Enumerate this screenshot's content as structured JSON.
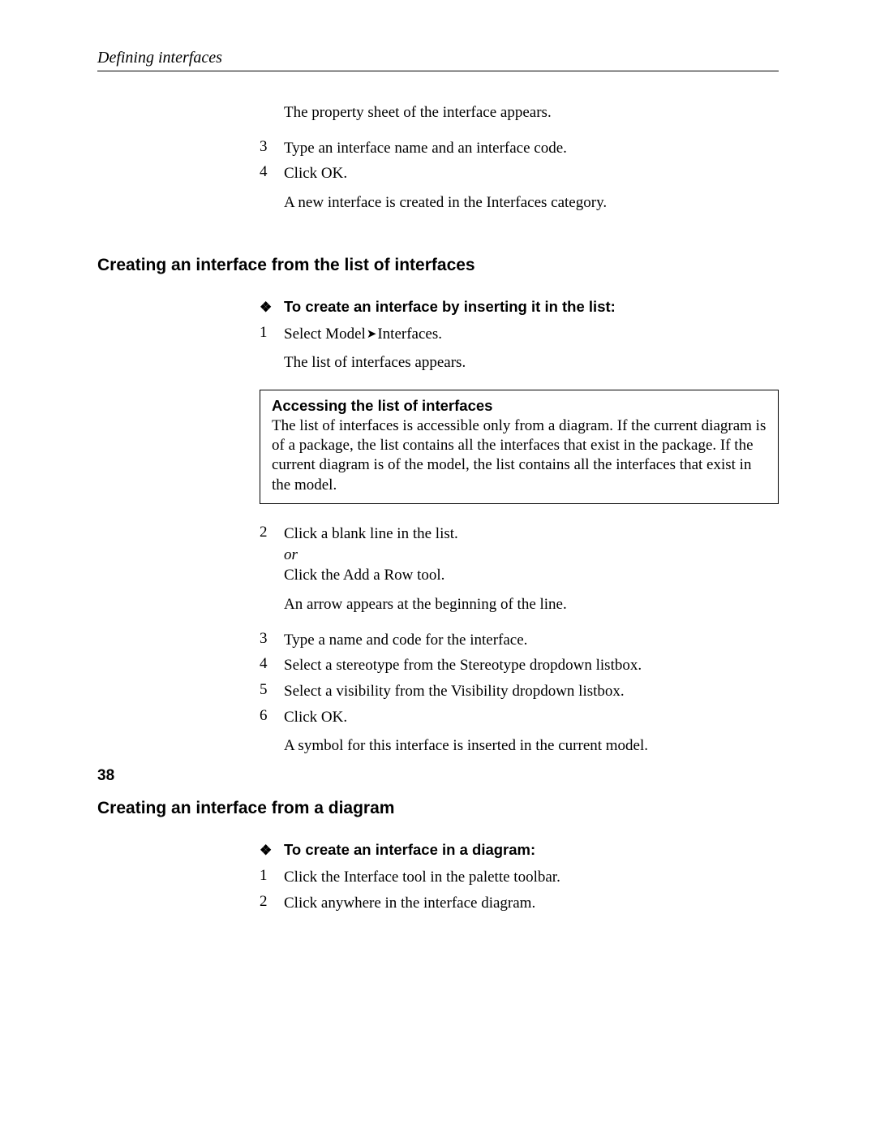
{
  "header": {
    "running_title": "Defining interfaces"
  },
  "intro_continuation": {
    "result1": "The property sheet of the interface appears.",
    "step3_num": "3",
    "step3": "Type an interface name and an interface code.",
    "step4_num": "4",
    "step4": "Click OK.",
    "result2": "A new interface is created in the Interfaces category."
  },
  "section_list": {
    "heading": "Creating an interface from the list of interfaces",
    "proc_heading": "To create an interface by inserting it in the list:",
    "step1_num": "1",
    "step1_pre": "Select Model",
    "step1_post": "Interfaces.",
    "step1_result": "The list of interfaces appears.",
    "note": {
      "title": "Accessing the list of interfaces",
      "body": "The list of interfaces is accessible only from a diagram. If the current diagram is of a package, the list contains all the interfaces that exist in the package. If the current diagram is of the model, the list contains all the interfaces that exist in the model."
    },
    "step2_num": "2",
    "step2_a": "Click a blank line in the list.",
    "step2_or": "or",
    "step2_b": "Click the Add a Row tool.",
    "step2_result": "An arrow appears at the beginning of the line.",
    "step3_num": "3",
    "step3": "Type a name and code for the interface.",
    "step4_num": "4",
    "step4": "Select a stereotype from the Stereotype dropdown listbox.",
    "step5_num": "5",
    "step5": "Select a visibility from the Visibility dropdown listbox.",
    "step6_num": "6",
    "step6": "Click OK.",
    "step6_result": "A symbol for this interface is inserted in the current model."
  },
  "section_diagram": {
    "heading": "Creating an interface from a diagram",
    "proc_heading": "To create an interface in a diagram:",
    "step1_num": "1",
    "step1": "Click the Interface tool in the palette toolbar.",
    "step2_num": "2",
    "step2": "Click anywhere in the interface diagram."
  },
  "page_number": "38"
}
